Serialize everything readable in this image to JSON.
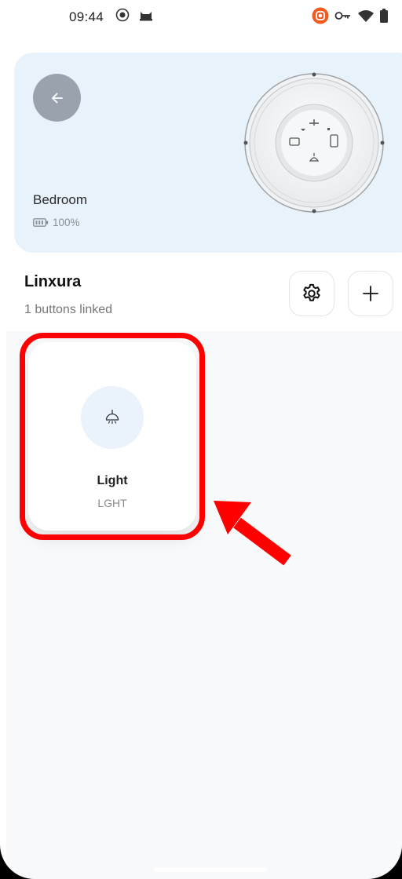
{
  "status_bar": {
    "time": "09:44",
    "icons_left": [
      "record-icon",
      "cat-icon"
    ],
    "icons_right": [
      "vpn-badge-icon",
      "key-icon",
      "wifi-icon",
      "battery-icon"
    ]
  },
  "device": {
    "name": "Bedroom",
    "battery": "100%",
    "back_icon": "arrow-left-icon"
  },
  "group": {
    "title": "Linxura",
    "subtitle": "1 buttons linked",
    "settings_icon": "gear-icon",
    "add_icon": "plus-icon"
  },
  "buttons": [
    {
      "label": "Light",
      "code": "LGHT",
      "icon": "ceiling-light-icon"
    }
  ],
  "colors": {
    "card_bg": "#e8f2fb",
    "back_button": "#9aa3ad",
    "highlight": "#ff0000"
  }
}
